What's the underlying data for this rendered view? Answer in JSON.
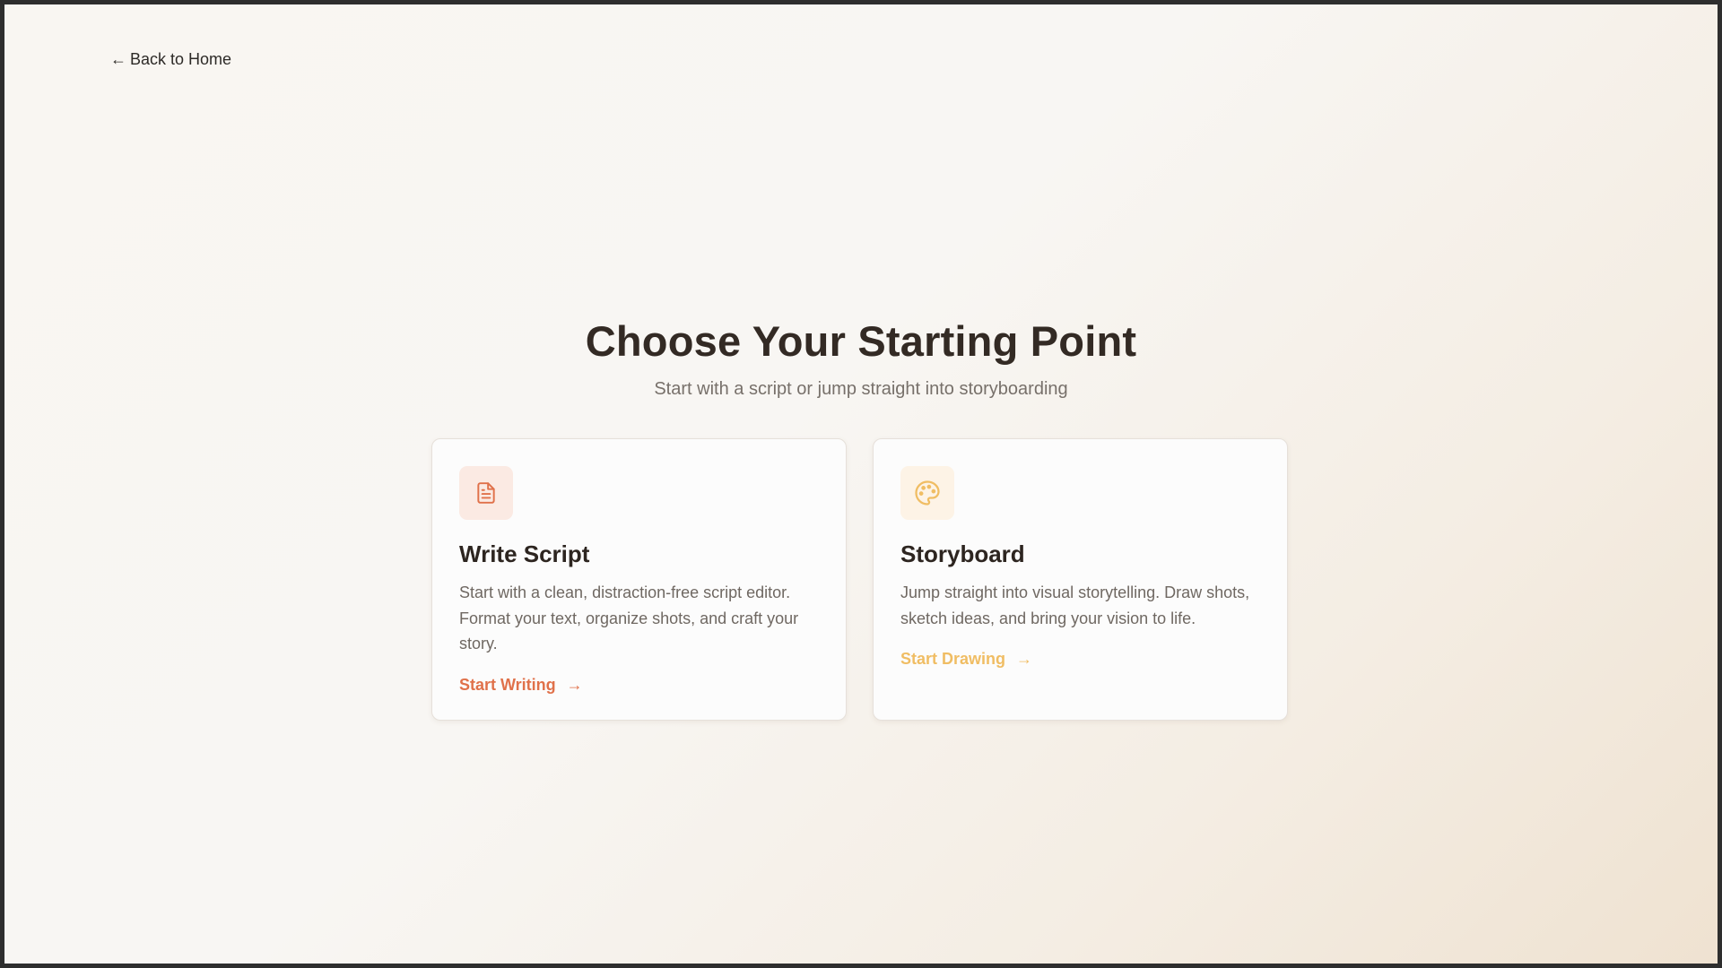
{
  "nav": {
    "back_arrow": "←",
    "back_label": "Back to Home"
  },
  "header": {
    "title": "Choose Your Starting Point",
    "subtitle": "Start with a script or jump straight into storyboarding"
  },
  "cards": [
    {
      "icon": "document-icon",
      "title": "Write Script",
      "description": "Start with a clean, distraction-free script editor. Format your text, organize shots, and craft your story.",
      "cta_label": "Start Writing",
      "cta_arrow": "→",
      "accent_color": "#e0714a"
    },
    {
      "icon": "palette-icon",
      "title": "Storyboard",
      "description": "Jump straight into visual storytelling. Draw shots, sketch ideas, and bring your vision to life.",
      "cta_label": "Start Drawing",
      "cta_arrow": "→",
      "accent_color": "#f0bd63"
    }
  ],
  "colors": {
    "heading": "#332a24",
    "subtext": "#77706a",
    "card_background": "#fcfcfc",
    "page_background": "#f8f6f3"
  }
}
